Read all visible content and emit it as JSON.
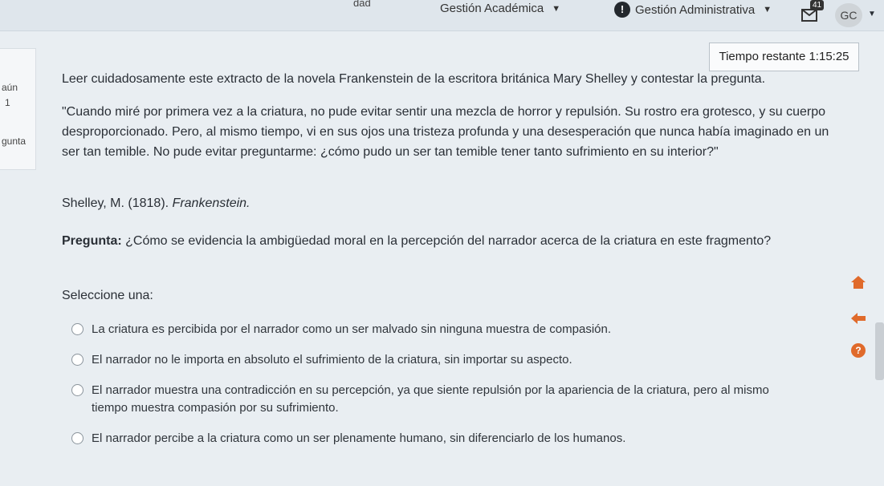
{
  "topbar": {
    "cut_text": "dad",
    "academic": "Gestión Académica",
    "admin": "Gestión Administrativa",
    "message_count": "41",
    "avatar": "GC"
  },
  "left_panel": {
    "line1": "aún",
    "line2": "1",
    "line3": "gunta"
  },
  "timer": {
    "label": "Tiempo restante 1:15:25"
  },
  "content": {
    "intro": "Leer cuidadosamente este extracto de la novela Frankenstein de la escritora británica Mary Shelley y contestar la pregunta.",
    "quote": "\"Cuando miré por primera vez a la criatura, no pude evitar sentir una mezcla de horror y repulsión. Su rostro era grotesco, y su cuerpo desproporcionado. Pero, al mismo tiempo, vi en sus ojos una tristeza profunda y una desesperación que nunca había imaginado en un ser tan temible. No pude evitar preguntarme: ¿cómo pudo un ser tan temible tener tanto sufrimiento en su interior?\"",
    "citation_author": "Shelley, M. (1818). ",
    "citation_title": "Frankenstein.",
    "question_label": "Pregunta:",
    "question_text": " ¿Cómo se evidencia la ambigüedad moral en la percepción del narrador acerca de la criatura en este fragmento?",
    "select_label": "Seleccione una:"
  },
  "options": [
    "La criatura es percibida por el narrador como un ser malvado sin ninguna muestra de compasión.",
    "El narrador no le importa en absoluto el sufrimiento de la criatura, sin importar su aspecto.",
    "El narrador muestra una contradicción en su percepción, ya que siente repulsión por la apariencia de la criatura, pero al mismo tiempo muestra compasión por su sufrimiento.",
    "El narrador percibe a la criatura como un ser plenamente humano, sin diferenciarlo de los humanos."
  ],
  "icons": {
    "home": "home-icon",
    "back": "arrow-left-icon",
    "help": "help-icon",
    "alert": "alert-icon",
    "messages": "message-icon"
  },
  "colors": {
    "help_accent": "#e06a2b",
    "background": "#e9eef2"
  }
}
